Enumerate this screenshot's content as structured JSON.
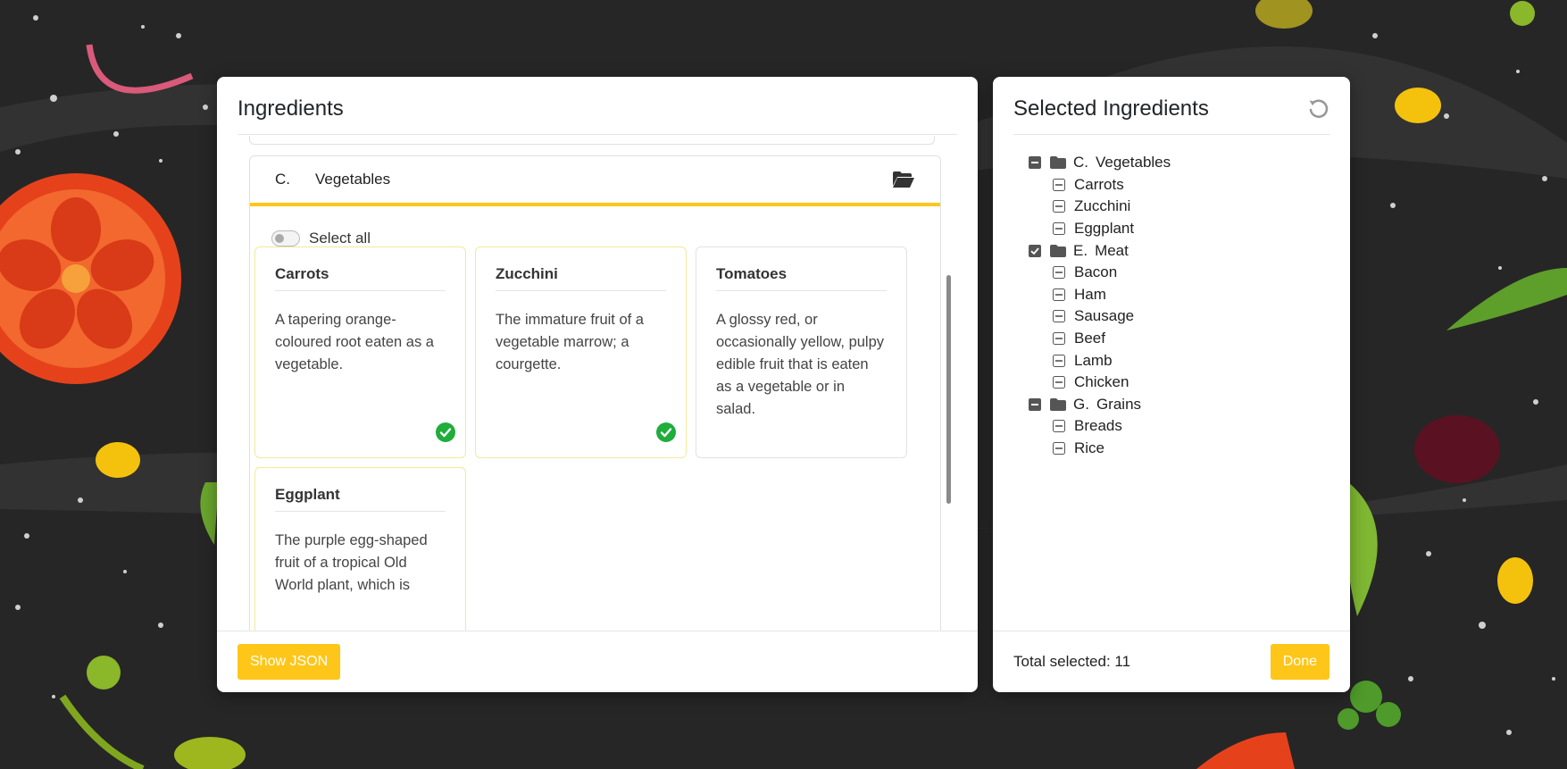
{
  "ingredients_panel": {
    "title": "Ingredients",
    "category": {
      "letter": "C.",
      "name": "Vegetables"
    },
    "select_all_label": "Select all",
    "select_all_on": false,
    "cards": [
      {
        "title": "Carrots",
        "description": "A tapering orange-coloured root eaten as a vegetable.",
        "selected": true
      },
      {
        "title": "Zucchini",
        "description": "The immature fruit of a vegetable marrow; a courgette.",
        "selected": true
      },
      {
        "title": "Tomatoes",
        "description": "A glossy red, or occasionally yellow, pulpy edible fruit that is eaten as a vegetable or in salad.",
        "selected": false
      },
      {
        "title": "Eggplant",
        "description": "The purple egg-shaped fruit of a tropical Old World plant, which is",
        "selected": true
      }
    ],
    "show_json_label": "Show JSON"
  },
  "selected_panel": {
    "title": "Selected Ingredients",
    "tree": [
      {
        "code": "C.",
        "name": "Vegetables",
        "state": "partial",
        "children": [
          "Carrots",
          "Zucchini",
          "Eggplant"
        ]
      },
      {
        "code": "E.",
        "name": "Meat",
        "state": "checked",
        "children": [
          "Bacon",
          "Ham",
          "Sausage",
          "Beef",
          "Lamb",
          "Chicken"
        ]
      },
      {
        "code": "G.",
        "name": "Grains",
        "state": "partial",
        "children": [
          "Breads",
          "Rice"
        ]
      }
    ],
    "total_label": "Total selected: 11",
    "done_label": "Done"
  },
  "colors": {
    "accent": "#ffc61a",
    "check_green": "#1fad3b",
    "background": "#262626"
  }
}
